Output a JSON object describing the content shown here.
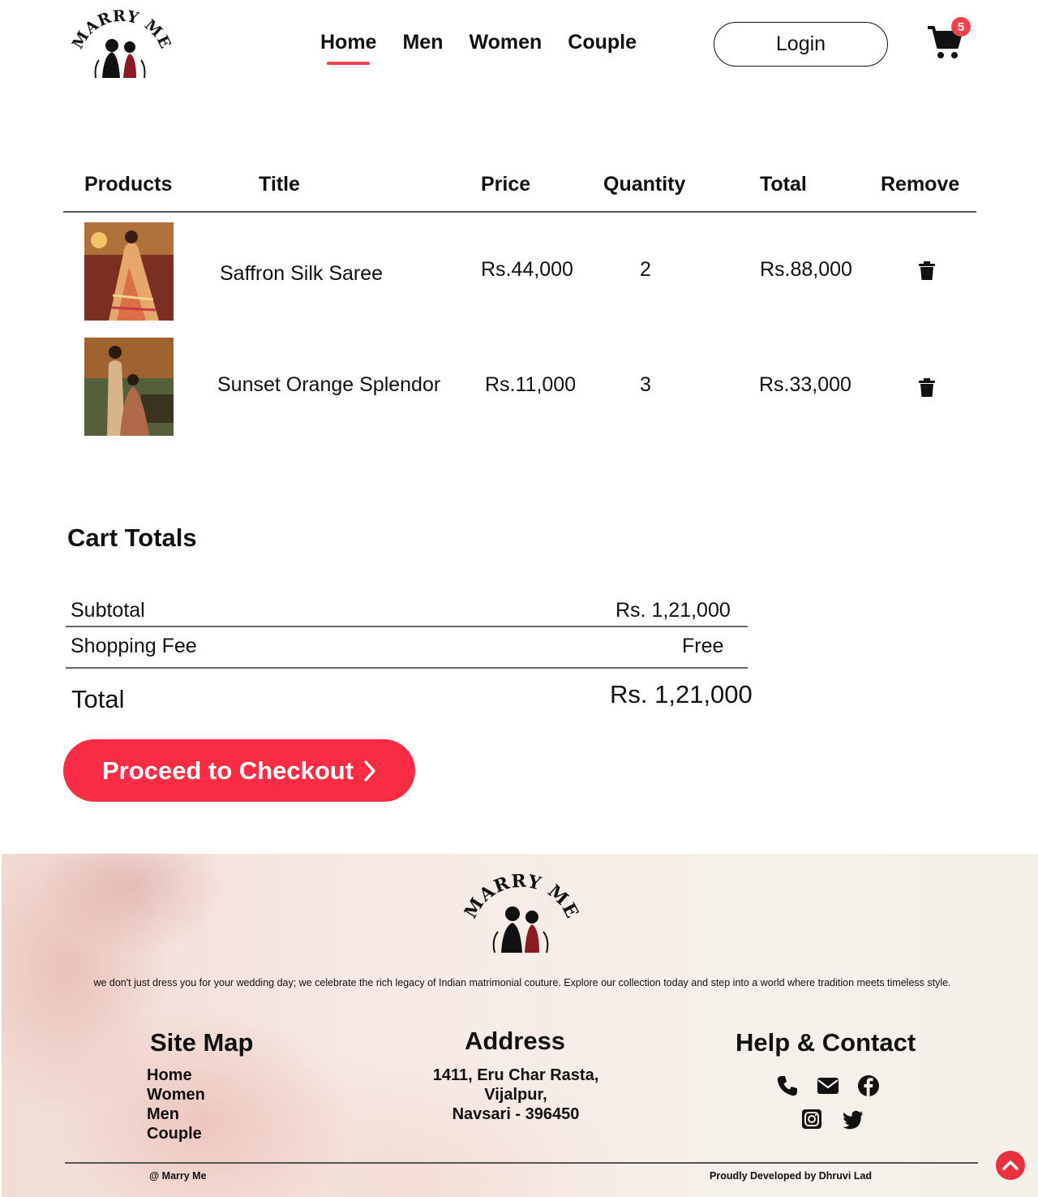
{
  "header": {
    "logo_text": "MARRY ME",
    "nav": [
      {
        "label": "Home",
        "active": true
      },
      {
        "label": "Men",
        "active": false
      },
      {
        "label": "Women",
        "active": false
      },
      {
        "label": "Couple",
        "active": false
      }
    ],
    "login_label": "Login",
    "cart_count": "5"
  },
  "cart": {
    "headers": [
      "Products",
      "Title",
      "Price",
      "Quantity",
      "Total",
      "Remove"
    ],
    "rows": [
      {
        "title": "Saffron Silk Saree",
        "price": "Rs.44,000",
        "quantity": "2",
        "total": "Rs.88,000"
      },
      {
        "title": "Sunset Orange Splendor",
        "price": "Rs.11,000",
        "quantity": "3",
        "total": "Rs.33,000"
      }
    ]
  },
  "cart_totals": {
    "title": "Cart Totals",
    "subtotal_label": "Subtotal",
    "subtotal_value": "Rs. 1,21,000",
    "shipping_label": "Shopping Fee",
    "shipping_value": "Free",
    "total_label": "Total",
    "total_value": "Rs. 1,21,000",
    "checkout_label": "Proceed to Checkout"
  },
  "footer": {
    "logo_text": "MARRY ME",
    "description": "we don't just dress you for your wedding day; we celebrate the rich legacy of Indian matrimonial couture. Explore our collection today and step into a world where tradition meets timeless style.",
    "sitemap_title": "Site Map",
    "sitemap_links": [
      "Home",
      "Women",
      "Men",
      "Couple"
    ],
    "address_title": "Address",
    "address_lines": [
      "1411, Eru Char Rasta,",
      "Vijalpur,",
      "Navsari - 396450"
    ],
    "help_title": "Help & Contact",
    "contact_icons": [
      "phone-icon",
      "envelope-icon",
      "facebook-icon",
      "instagram-icon",
      "twitter-icon"
    ],
    "copyright": "@ Marry Me",
    "credit": "Proudly Developed by Dhruvi Lad"
  },
  "colors": {
    "accent": "#f92c43",
    "badge": "#f0414f"
  }
}
